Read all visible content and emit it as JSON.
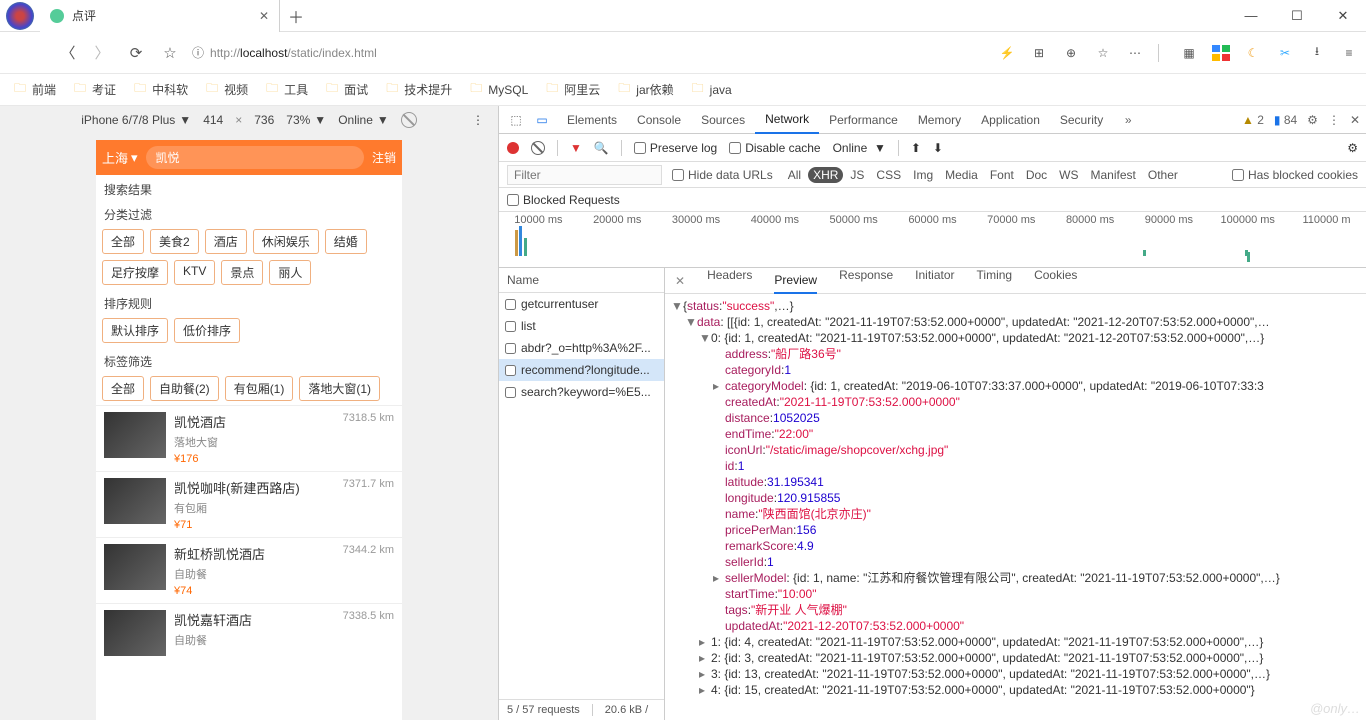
{
  "browser": {
    "tab_title": "点评",
    "url_prefix": "http://",
    "url_host": "localhost",
    "url_path": "/static/index.html",
    "bookmarks": [
      "前端",
      "考证",
      "中科软",
      "视频",
      "工具",
      "面试",
      "技术提升",
      "MySQL",
      "阿里云",
      "jar依赖",
      "java"
    ]
  },
  "devbar": {
    "device": "iPhone 6/7/8 Plus",
    "w": "414",
    "h": "736",
    "zoom": "73%",
    "online": "Online"
  },
  "app": {
    "city": "上海",
    "search_value": "凯悦",
    "register": "注销",
    "sec_search": "搜索结果",
    "sec_cat": "分类过滤",
    "cats": [
      "全部",
      "美食2",
      "酒店",
      "休闲娱乐",
      "结婚",
      "足疗按摩",
      "KTV",
      "景点",
      "丽人"
    ],
    "sec_sort": "排序规则",
    "sorts": [
      "默认排序",
      "低价排序"
    ],
    "sec_tag": "标签筛选",
    "tagfilters": [
      "全部",
      "自助餐(2)",
      "有包厢(1)",
      "落地大窗(1)"
    ],
    "shops": [
      {
        "title": "凯悦酒店",
        "sub": "落地大窗",
        "price": "¥176",
        "dist": "7318.5 km"
      },
      {
        "title": "凯悦咖啡(新建西路店)",
        "sub": "有包厢",
        "price": "¥71",
        "dist": "7371.7 km"
      },
      {
        "title": "新虹桥凯悦酒店",
        "sub": "自助餐",
        "price": "¥74",
        "dist": "7344.2 km"
      },
      {
        "title": "凯悦嘉轩酒店",
        "sub": "自助餐",
        "price": "",
        "dist": "7338.5 km"
      }
    ]
  },
  "devtools": {
    "tabs": [
      "Elements",
      "Console",
      "Sources",
      "Network",
      "Performance",
      "Memory",
      "Application",
      "Security"
    ],
    "active_tab": "Network",
    "warn": "2",
    "msg": "84",
    "toolbar": {
      "preserve": "Preserve log",
      "disable": "Disable cache",
      "online": "Online"
    },
    "filter_placeholder": "Filter",
    "hide_urls": "Hide data URLs",
    "types": [
      "All",
      "XHR",
      "JS",
      "CSS",
      "Img",
      "Media",
      "Font",
      "Doc",
      "WS",
      "Manifest",
      "Other"
    ],
    "active_type": "XHR",
    "blocked_cookies": "Has blocked cookies",
    "blocked_req": "Blocked Requests",
    "timeline_ticks": [
      "10000 ms",
      "20000 ms",
      "30000 ms",
      "40000 ms",
      "50000 ms",
      "60000 ms",
      "70000 ms",
      "80000 ms",
      "90000 ms",
      "100000 ms",
      "110000 m"
    ],
    "requests": {
      "header": "Name",
      "items": [
        "getcurrentuser",
        "list",
        "abdr?_o=http%3A%2F...",
        "recommend?longitude...",
        "search?keyword=%E5..."
      ],
      "selected_idx": 3,
      "footer_left": "5 / 57 requests",
      "footer_right": "20.6 kB /"
    },
    "detail_tabs": [
      "Headers",
      "Preview",
      "Response",
      "Initiator",
      "Timing",
      "Cookies"
    ],
    "active_detail": "Preview"
  },
  "chart_data": {
    "type": "table",
    "title": "Network Preview — search?keyword=...",
    "root": {
      "status": "success"
    },
    "data_summary": "data: [{id: 1, createdAt: \"2021-11-19T07:53:52.000+0000\", updatedAt: \"2021-12-20T07:53:52.000+0000\",…",
    "item0_summary": "0: {id: 1, createdAt: \"2021-11-19T07:53:52.000+0000\", updatedAt: \"2021-12-20T07:53:52.000+0000\",…}",
    "item0": {
      "address": "船厂路36号",
      "categoryId": 1,
      "categoryModel_summary": "{id: 1, createdAt: \"2019-06-10T07:33:37.000+0000\", updatedAt: \"2019-06-10T07:33:3",
      "createdAt": "2021-11-19T07:53:52.000+0000",
      "distance": 1052025,
      "endTime": "22:00",
      "iconUrl": "/static/image/shopcover/xchg.jpg",
      "id": 1,
      "latitude": 31.195341,
      "longitude": 120.915855,
      "name": "陕西面馆(北京亦庄)",
      "pricePerMan": 156,
      "remarkScore": 4.9,
      "sellerId": 1,
      "sellerModel_summary": "{id: 1, name: \"江苏和府餐饮管理有限公司\", createdAt: \"2021-11-19T07:53:52.000+0000\",…}",
      "startTime": "10:00",
      "tags": "新开业 人气爆棚",
      "updatedAt": "2021-12-20T07:53:52.000+0000"
    },
    "siblings": [
      "1: {id: 4, createdAt: \"2021-11-19T07:53:52.000+0000\", updatedAt: \"2021-11-19T07:53:52.000+0000\",…}",
      "2: {id: 3, createdAt: \"2021-11-19T07:53:52.000+0000\", updatedAt: \"2021-11-19T07:53:52.000+0000\",…}",
      "3: {id: 13, createdAt: \"2021-11-19T07:53:52.000+0000\", updatedAt: \"2021-11-19T07:53:52.000+0000\",…}",
      "4: {id: 15, createdAt: \"2021-11-19T07:53:52.000+0000\", updatedAt: \"2021-11-19T07:53:52.000+0000\"}"
    ]
  }
}
